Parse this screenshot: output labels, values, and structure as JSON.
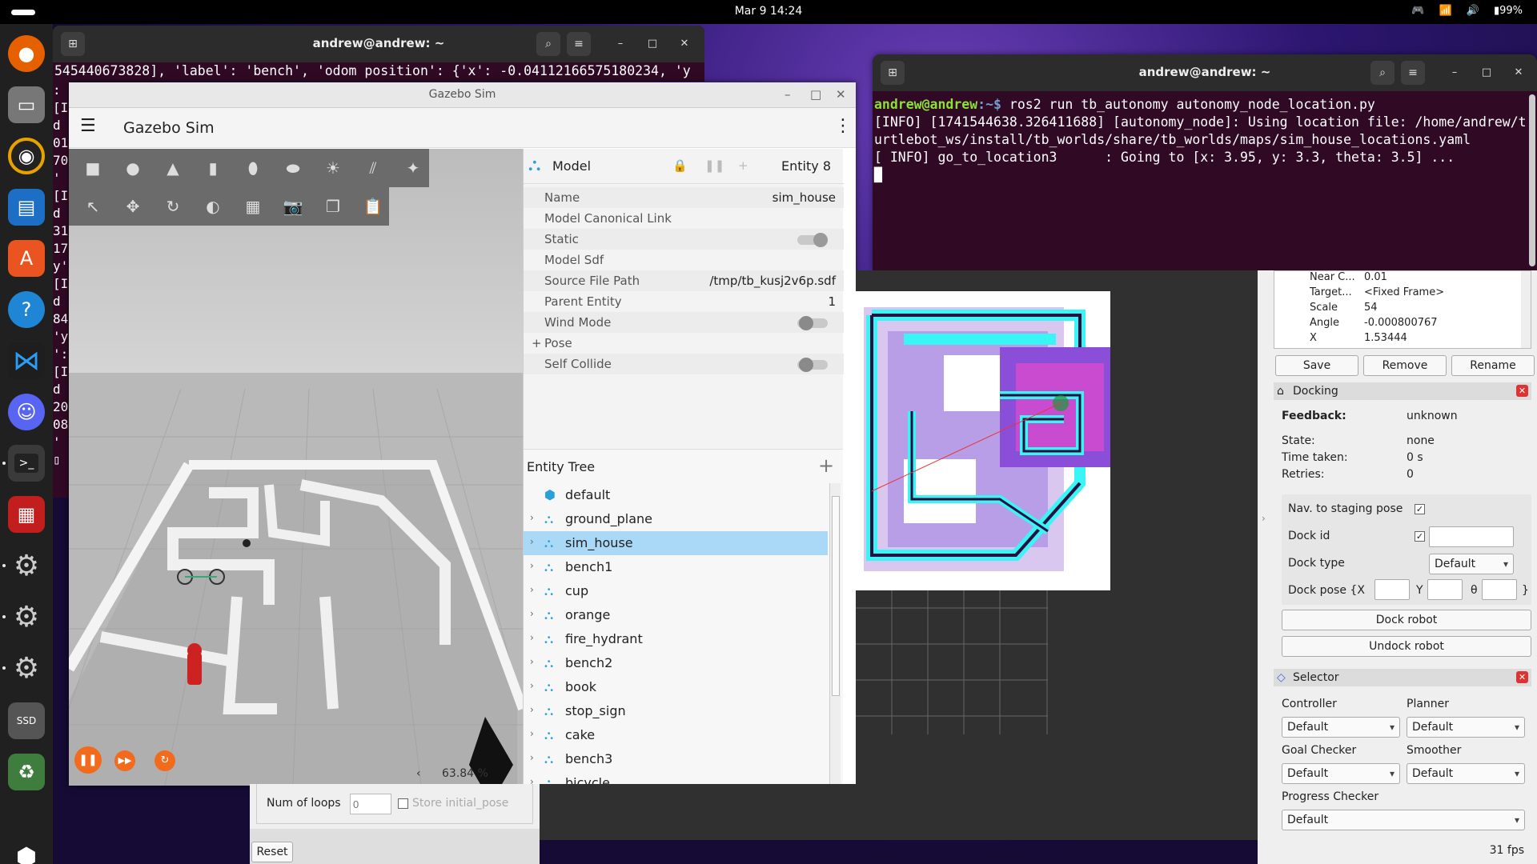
{
  "topbar": {
    "clock": "Mar 9  14:24",
    "battery": "99%"
  },
  "terminal_left": {
    "title": "andrew@andrew: ~",
    "line1": "545440673828], 'label': 'bench', 'odom position': {'x': -0.04112166575180234, 'y",
    "side_lines": [
      ":",
      "[I",
      "d",
      "01",
      "70",
      "'",
      "[I",
      "d",
      "31",
      "17",
      "y'",
      "[I",
      "d",
      "84",
      "'y",
      "':",
      "[I",
      "d",
      "20",
      "08",
      "'",
      "▯"
    ]
  },
  "gazebo": {
    "window_title": "Gazebo Sim",
    "app_title": "Gazebo Sim",
    "scene_percent": "63.84 %",
    "model_panel": {
      "header": "Model",
      "entity": "Entity 8",
      "rows": [
        {
          "k": "Name",
          "v": "sim_house"
        },
        {
          "k": "Model Canonical Link",
          "v": ""
        },
        {
          "k": "Static",
          "v": ""
        },
        {
          "k": "Model Sdf",
          "v": ""
        },
        {
          "k": "Source File Path",
          "v": "/tmp/tb_kusj2v6p.sdf"
        },
        {
          "k": "Parent Entity",
          "v": "1"
        },
        {
          "k": "Wind Mode",
          "v": ""
        },
        {
          "k": "Pose",
          "v": ""
        },
        {
          "k": "Self Collide",
          "v": ""
        }
      ]
    },
    "entity_tree": {
      "header": "Entity Tree",
      "items": [
        "default",
        "ground_plane",
        "sim_house",
        "bench1",
        "cup",
        "orange",
        "fire_hydrant",
        "bench2",
        "book",
        "stop_sign",
        "cake",
        "bench3",
        "bicycle"
      ]
    }
  },
  "terminal_right": {
    "title": "andrew@andrew: ~",
    "prompt_user": "andrew@andrew",
    "prompt_path": ":~$ ",
    "command": "ros2 run tb_autonomy autonomy_node_location.py",
    "out1": "[INFO] [1741544638.326411688] [autonomy_node]: Using location file: /home/andrew/t",
    "out2": "urtlebot_ws/install/tb_worlds/share/tb_worlds/maps/sim_house_locations.yaml",
    "out3": "[ INFO] go_to_location3      : Going to [x: 3.95, y: 3.3, theta: 3.5] ..."
  },
  "rviz": {
    "props": [
      {
        "k": "Near C...",
        "v": "0.01"
      },
      {
        "k": "Target...",
        "v": "<Fixed Frame>"
      },
      {
        "k": "Scale",
        "v": "54"
      },
      {
        "k": "Angle",
        "v": "-0.000800767"
      },
      {
        "k": "X",
        "v": "1.53444"
      }
    ],
    "buttons": {
      "save": "Save",
      "remove": "Remove",
      "rename": "Rename"
    },
    "docking": {
      "title": "Docking",
      "feedback_label": "Feedback:",
      "feedback_value": "unknown",
      "state_label": "State:",
      "state_value": "none",
      "time_label": "Time taken:",
      "time_value": "0 s",
      "retries_label": "Retries:",
      "retries_value": "0",
      "nav_staging": "Nav. to staging pose",
      "dock_id": "Dock id",
      "dock_type": "Dock type",
      "dock_type_value": "Default",
      "dock_pose": "Dock pose {X",
      "y": "Y",
      "theta": "θ",
      "close": "}",
      "dock_btn": "Dock robot",
      "undock_btn": "Undock robot"
    },
    "selector": {
      "title": "Selector",
      "controller": "Controller",
      "controller_value": "Default",
      "planner": "Planner",
      "planner_value": "Default",
      "goal_checker": "Goal Checker",
      "goal_checker_value": "Default",
      "smoother": "Smoother",
      "smoother_value": "Default",
      "progress_checker": "Progress Checker",
      "progress_checker_value": "Default"
    },
    "fps": "31 fps"
  },
  "loops_panel": {
    "label": "Num of loops",
    "placeholder": "0",
    "store": "Store initial_pose",
    "reset": "Reset"
  }
}
